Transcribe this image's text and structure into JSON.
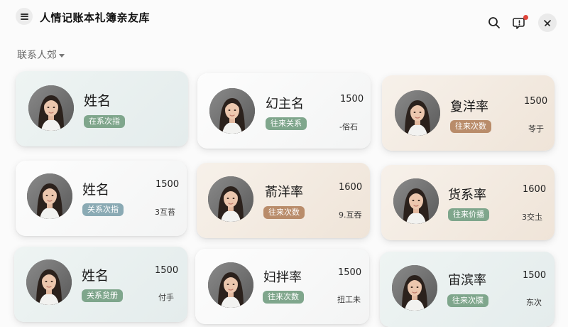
{
  "header": {
    "title": "人情记账本礼簿亲友库",
    "menu_icon": "hamburger-icon",
    "search_icon": "search-icon",
    "message_icon": "message-icon",
    "close_icon": "close-icon",
    "notification_color": "#e0463c"
  },
  "section": {
    "label": "联系人郊"
  },
  "contacts": [
    {
      "name": "姓名",
      "tag": "在系次指",
      "amount": "",
      "note": ""
    },
    {
      "name": "幻主名",
      "tag": "往来关系",
      "amount": "1500",
      "note": "-俗石"
    },
    {
      "name": "夐洋率",
      "tag": "往来次数",
      "amount": "1500",
      "note": "苓于"
    },
    {
      "name": "姓名",
      "tag": "关系次指",
      "amount": "1500",
      "note": "3互苔"
    },
    {
      "name": "萮洋率",
      "tag": "往来次数",
      "amount": "1600",
      "note": "9.互吞"
    },
    {
      "name": "货系率",
      "tag": "往来价播",
      "amount": "1600",
      "note": "3交圡"
    },
    {
      "name": "姓名",
      "tag": "关系炱册",
      "amount": "1500",
      "note": "付手"
    },
    {
      "name": "妇拌率",
      "tag": "往来次数",
      "amount": "1500",
      "note": "扭工未"
    },
    {
      "name": "宙滨率",
      "tag": "往来次牒",
      "amount": "1500",
      "note": "东次"
    }
  ],
  "colors": {
    "tag_green": "#7fa68c",
    "tag_blue": "#8aaab4",
    "tag_brown": "#b98c6a"
  }
}
